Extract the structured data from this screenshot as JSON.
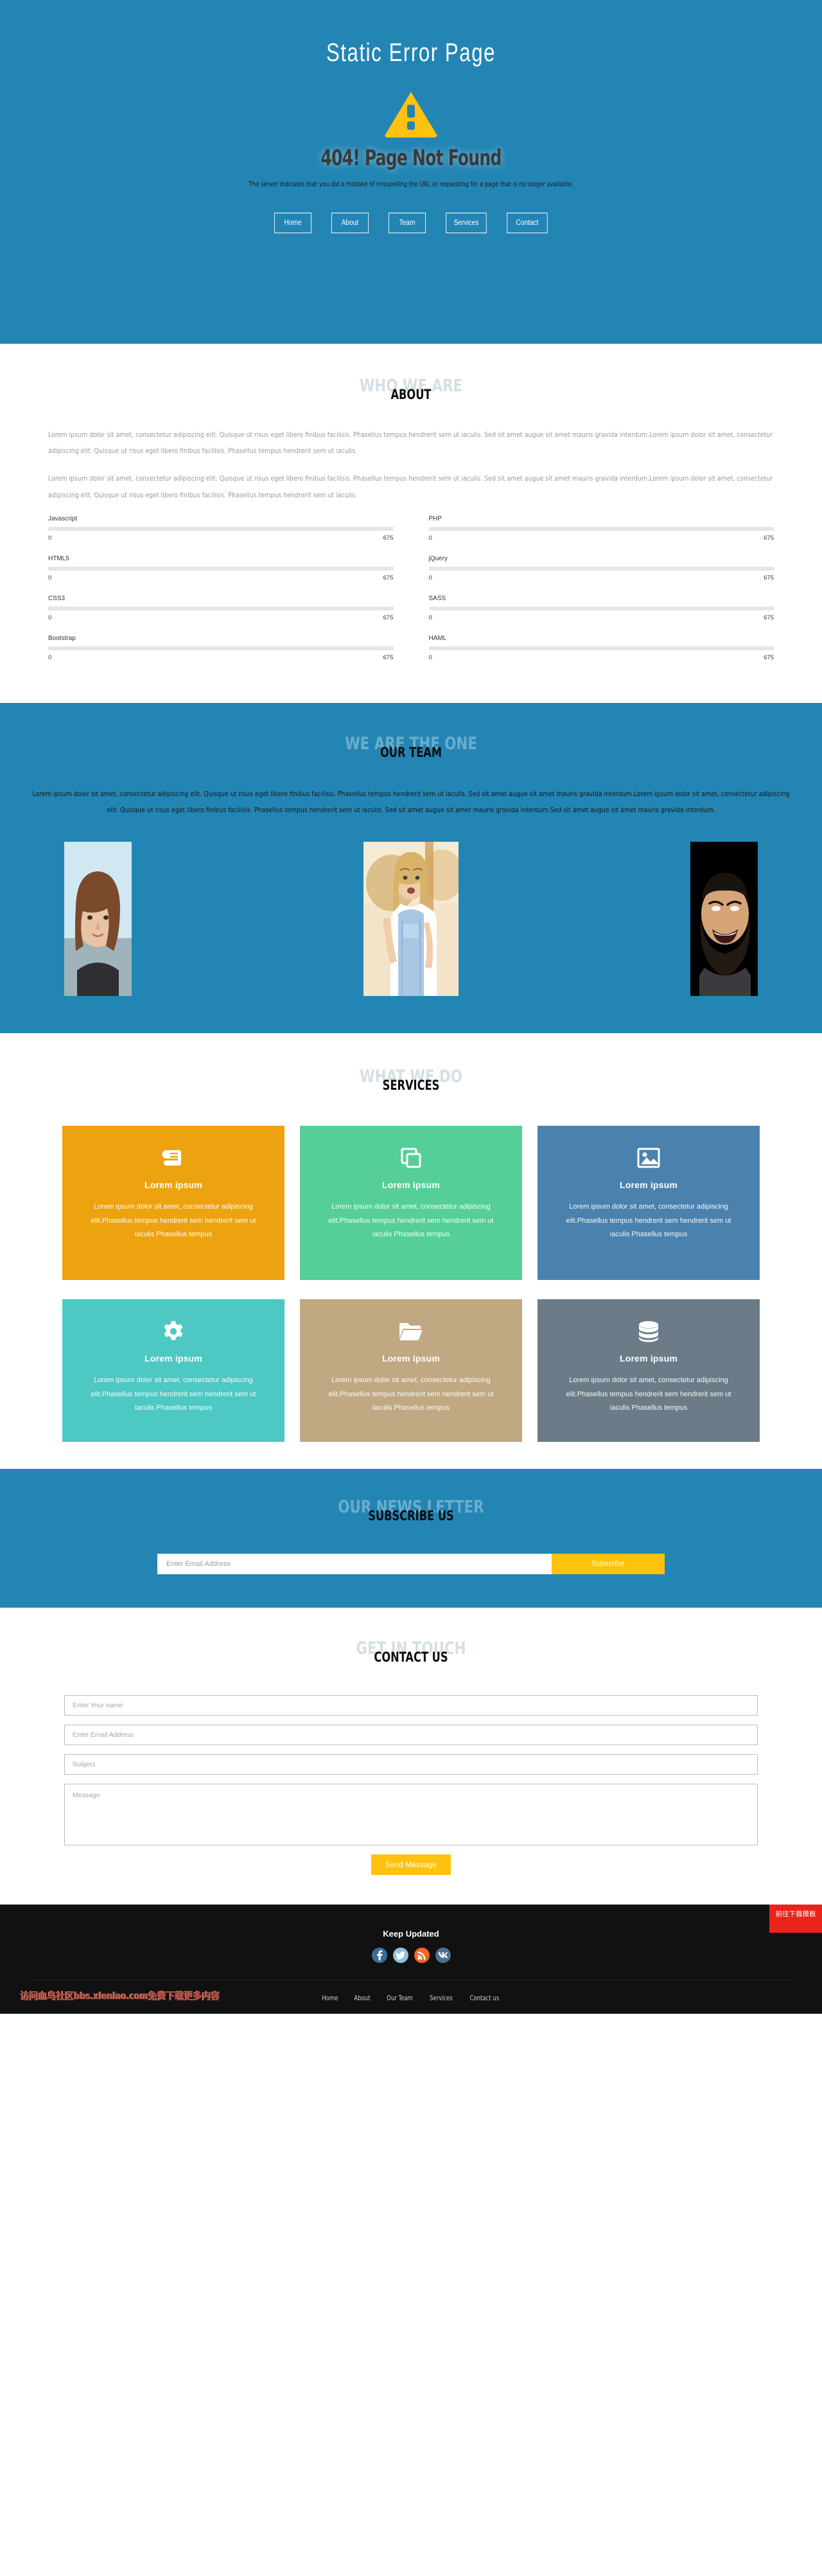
{
  "hero": {
    "title": "Static Error Page",
    "icon": "warning-triangle-icon",
    "error_code": "404! Page Not Found",
    "error_message": "The server indicates that you did a mistake of misspelling the URL or requesting for a page that is no longer available.",
    "accent_color": "#2385b4",
    "warning_color": "#ffc20e",
    "nav": [
      {
        "label": "Home"
      },
      {
        "label": "About"
      },
      {
        "label": "Team"
      },
      {
        "label": "Services"
      },
      {
        "label": "Contact"
      }
    ]
  },
  "about": {
    "ghost_heading": "WHO WE ARE",
    "heading": "ABOUT",
    "paragraphs": [
      "Lorem ipsum dolor sit amet, consectetur adipiscing elit. Quisque ut risus eget libero finibus facilisis. Phasellus tempus hendrerit sem ut iaculis. Sed sit amet augue sit amet mauris gravida interdum.Lorem ipsum dolor sit amet, consectetur adipiscing elit. Quisque ut risus eget libero finibus facilisis. Phasellus tempus hendrerit sem ut iaculis.",
      "Lorem ipsum dolor sit amet, consectetur adipiscing elit. Quisque ut risus eget libero finibus facilisis. Phasellus tempus hendrerit sem ut iaculis. Sed sit amet augue sit amet mauris gravida interdum.Lorem ipsum dolor sit amet, consectetur adipiscing elit. Quisque ut risus eget libero finibus facilisis. Phasellus tempus hendrerit sem ut iaculis."
    ],
    "skills_left": [
      {
        "name": "Javascript",
        "min": "0",
        "max": "675"
      },
      {
        "name": "HTML5",
        "min": "0",
        "max": "675"
      },
      {
        "name": "CSS3",
        "min": "0",
        "max": "675"
      },
      {
        "name": "Bootstrap",
        "min": "0",
        "max": "675"
      }
    ],
    "skills_right": [
      {
        "name": "PHP",
        "min": "0",
        "max": "675"
      },
      {
        "name": "jQuery",
        "min": "0",
        "max": "675"
      },
      {
        "name": "SASS",
        "min": "0",
        "max": "675"
      },
      {
        "name": "HAML",
        "min": "0",
        "max": "675"
      }
    ]
  },
  "team": {
    "ghost_heading": "WE ARE THE ONE",
    "heading": "OUR TEAM",
    "paragraph": "Lorem ipsum dolor sit amet, consectetur adipiscing elit. Quisque ut risus eget libero finibus facilisis. Phasellus tempus hendrerit sem ut iaculis. Sed sit amet augue sit amet mauris gravida interdum.Lorem ipsum dolor sit amet, consectetur adipiscing elit. Quisque ut risus eget libero finibus facilisis. Phasellus tempus hendrerit sem ut iaculis. Sed sit amet augue sit amet mauris gravida interdum.Sed sit amet augue sit amet mauris gravida interdum.",
    "members": [
      {
        "photo": "portrait-woman-bob-haircut"
      },
      {
        "photo": "portrait-woman-overalls-outdoor"
      },
      {
        "photo": "portrait-bearded-man-laughing"
      }
    ]
  },
  "services": {
    "ghost_heading": "WHAT WE DO",
    "heading": "SERVICES",
    "cards": [
      {
        "icon": "book-icon",
        "title": "Lorem ipsum",
        "text": "Lorem ipsum dolor sit amet, consectetur adipiscing elit.Phasellus tempus hendrerit sem hendrerit sem ut iaculis Phasellus tempus",
        "color": "#eda310"
      },
      {
        "icon": "clone-icon",
        "title": "Lorem ipsum",
        "text": "Lorem ipsum dolor sit amet, consectetur adipiscing elit.Phasellus tempus hendrerit sem hendrerit sem ut iaculis Phasellus tempus",
        "color": "#55cf97"
      },
      {
        "icon": "image-icon",
        "title": "Lorem ipsum",
        "text": "Lorem ipsum dolor sit amet, consectetur adipiscing elit.Phasellus tempus hendrerit sem hendrerit sem ut iaculis Phasellus tempus",
        "color": "#4a82ad"
      },
      {
        "icon": "gear-icon",
        "title": "Lorem ipsum",
        "text": "Lorem ipsum dolor sit amet, consectetur adipiscing elit.Phasellus tempus hendrerit sem hendrerit sem ut iaculis Phasellus tempus",
        "color": "#4dc8c3"
      },
      {
        "icon": "folder-icon",
        "title": "Lorem ipsum",
        "text": "Lorem ipsum dolor sit amet, consectetur adipiscing elit.Phasellus tempus hendrerit sem hendrerit sem ut iaculis Phasellus tempus",
        "color": "#c0a882"
      },
      {
        "icon": "database-icon",
        "title": "Lorem ipsum",
        "text": "Lorem ipsum dolor sit amet, consectetur adipiscing elit.Phasellus tempus hendrerit sem hendrerit sem ut iaculis Phasellus tempus",
        "color": "#6b7c88"
      }
    ]
  },
  "subscribe": {
    "ghost_heading": "OUR NEWS LETTER",
    "heading": "SUBSCRIBE US",
    "email_placeholder": "Enter Email Address",
    "email_value": "",
    "button_label": "Subscribe",
    "button_color": "#ffc20e"
  },
  "contact": {
    "ghost_heading": "GET IN TOUCH",
    "heading": "CONTACT US",
    "name_placeholder": "Enter Your name",
    "email_placeholder": "Enter Email Address",
    "subject_placeholder": "Subject",
    "message_placeholder": "Message",
    "name_value": "",
    "email_value": "",
    "subject_value": "",
    "message_value": "",
    "submit_label": "Send Message"
  },
  "footer": {
    "title": "Keep Updated",
    "socials": [
      {
        "name": "facebook-icon",
        "color": "#3a6d96"
      },
      {
        "name": "twitter-icon",
        "color": "#8dc2dc"
      },
      {
        "name": "rss-icon",
        "color": "#f26522"
      },
      {
        "name": "vk-icon",
        "color": "#4a6f91"
      }
    ],
    "links": [
      {
        "label": "Home"
      },
      {
        "label": "About"
      },
      {
        "label": "Our Team"
      },
      {
        "label": "Services"
      },
      {
        "label": "Contact us"
      }
    ],
    "watermark": "访问血鸟社区bbs.xlenlao.com免费下载更多内容",
    "download_badge": "前往下载模板"
  }
}
